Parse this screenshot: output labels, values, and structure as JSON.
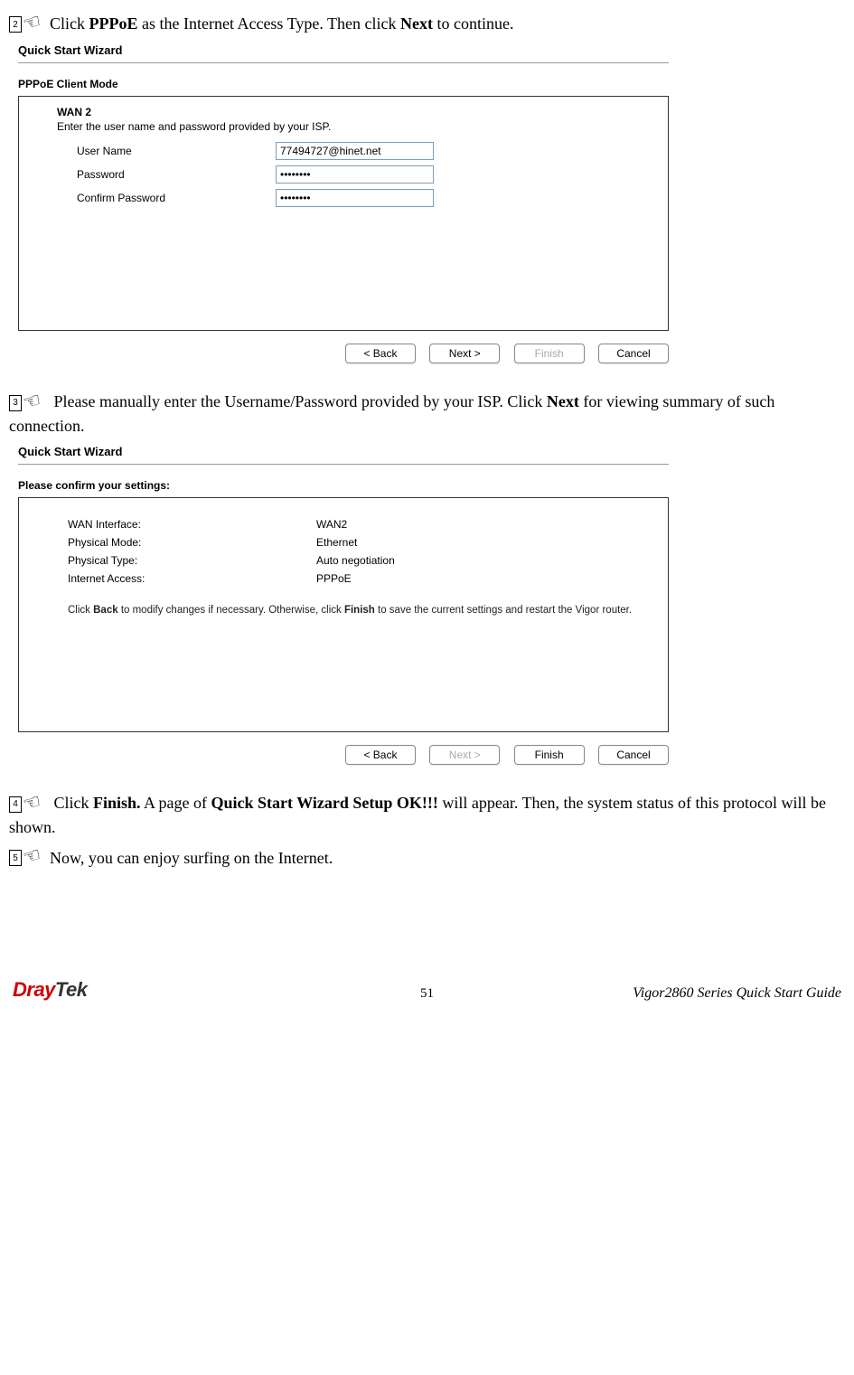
{
  "steps": {
    "s1": {
      "num": "2",
      "text_before": "Click ",
      "bold1": "PPPoE",
      "text_mid": " as the Internet Access Type. Then click ",
      "bold2": "Next",
      "text_after": " to continue."
    },
    "s2": {
      "num": "3",
      "text_before": "Please manually enter the Username/Password provided by your ISP. Click ",
      "bold1": "Next",
      "text_after": " for viewing summary of such connection."
    },
    "s3": {
      "num": "4",
      "text_before": "Click ",
      "bold1": "Finish.",
      "text_mid": " A page of ",
      "bold2": "Quick Start Wizard Setup OK!!!",
      "text_after": " will appear. Then, the system status of this protocol will be shown."
    },
    "s4": {
      "num": "5",
      "text": "Now, you can enjoy surfing on the Internet."
    }
  },
  "wizard1": {
    "title": "Quick Start Wizard",
    "subtitle": "PPPoE Client Mode",
    "section_label": "WAN 2",
    "section_desc": "Enter the user name and password provided by your ISP.",
    "fields": {
      "user_label": "User Name",
      "user_value": "77494727@hinet.net",
      "pass_label": "Password",
      "pass_value": "••••••••",
      "confirm_label": "Confirm Password",
      "confirm_value": "••••••••"
    },
    "btn_back": "< Back",
    "btn_next": "Next >",
    "btn_finish": "Finish",
    "btn_cancel": "Cancel"
  },
  "wizard2": {
    "title": "Quick Start Wizard",
    "subtitle": "Please confirm your settings:",
    "rows": {
      "r1l": "WAN Interface:",
      "r1v": "WAN2",
      "r2l": "Physical Mode:",
      "r2v": "Ethernet",
      "r3l": "Physical Type:",
      "r3v": "Auto negotiation",
      "r4l": "Internet Access:",
      "r4v": "PPPoE"
    },
    "hint_a": "Click ",
    "hint_b1": "Back",
    "hint_b": "  to modify changes if necessary. Otherwise, click ",
    "hint_b2": "Finish",
    "hint_c": "  to save the current settings and restart the Vigor router.",
    "btn_back": "< Back",
    "btn_next": "Next >",
    "btn_finish": "Finish",
    "btn_cancel": "Cancel"
  },
  "footer": {
    "logo1": "Dray",
    "logo2": "Tek",
    "page": "51",
    "right": "Vigor2860 Series Quick Start Guide"
  }
}
